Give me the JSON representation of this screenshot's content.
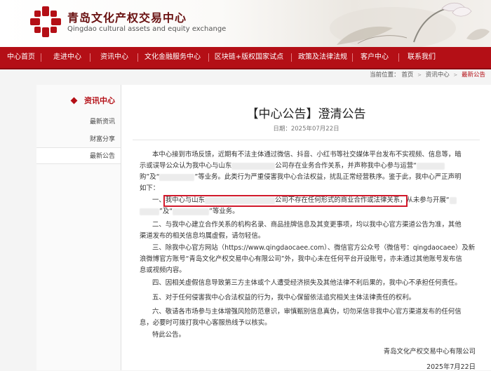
{
  "header": {
    "logo_title": "青岛文化产权交易中心",
    "logo_subtitle": "Qingdao cultural assets and equity exchange",
    "logo_color": "#b40f16"
  },
  "nav": {
    "items": [
      "中心首页",
      "走进中心",
      "资讯中心",
      "文化金融服务中心",
      "区块链+版权国家试点",
      "政策及法律法规",
      "客户中心",
      "联系我们"
    ],
    "background": "#b40f16"
  },
  "breadcrumb": {
    "prefix": "当前位置：",
    "items": [
      "首页",
      "资讯中心",
      "最新公告"
    ],
    "separator_icon": "chevron-right-icon"
  },
  "sidebar": {
    "title": "资讯中心",
    "items": [
      "最新资讯",
      "财富分享",
      "最新公告"
    ],
    "active": "最新公告"
  },
  "article": {
    "title": "【中心公告】澄清公告",
    "date": "日期：2025年07月22日",
    "p1": {
      "l1": "本中心接到市场反馈，近期有不法主体通过微信、抖音、小红书等社交媒体平台发布不实视频、信息等，暗",
      "l2a": "示或误导公众认为我中心与山东",
      "l2b": "公司存在业务合作关系，并声称我中心参与运营“",
      "l3a": "购”及“",
      "l3b": "”等业务。此类行为严重侵害我中心合法权益，扰乱正常经营秩序。鉴于此，我中心严正声明",
      "l4": "如下："
    },
    "p2": {
      "l1a": "一、",
      "l1b": "我中心与山东",
      "l1c": "公司不存在任何形式的商业合作或法律关系，",
      "l1d": "从未参与开展“",
      "l2a": "”及“",
      "l2b": "”等业务。"
    },
    "p3": {
      "l1": "二、与我中心建立合作关系的机构名录、商品挂牌信息及其变更事项，均以我中心官方渠道公告为准，其他",
      "l2": "渠道发布的相关信息均属虚假，请勿轻信。"
    },
    "p4": {
      "l1": "三、除我中心官方网站（https://www.qingdaocaee.com）、微信官方公众号（微信号：qingdaocaee）及新",
      "l2": "浪微博官方账号“青岛文化产权交易中心有限公司”外，我中心未在任何平台开设账号，亦未通过其他账号发布信",
      "l3": "息或视频内容。"
    },
    "p5": "四、因相关虚假信息导致第三方主体或个人遭受经济损失及其他法律不利后果的，我中心不承担任何责任。",
    "p6": "五、对于任何侵害我中心合法权益的行为，我中心保留依法追究相关主体法律责任的权利。",
    "p7": {
      "l1": "六、敬请各市场参与主体增强风险防范意识，审慎甄别信息真伪，切勿采信非我中心官方渠道发布的任何信",
      "l2": "息，必要时可拨打我中心客服热线予以核实。"
    },
    "p8": "特此公告。",
    "signature_org": "青岛文化产权交易中心有限公司",
    "signature_date": "2025年7月22日",
    "highlight_color": "#d1192b"
  }
}
